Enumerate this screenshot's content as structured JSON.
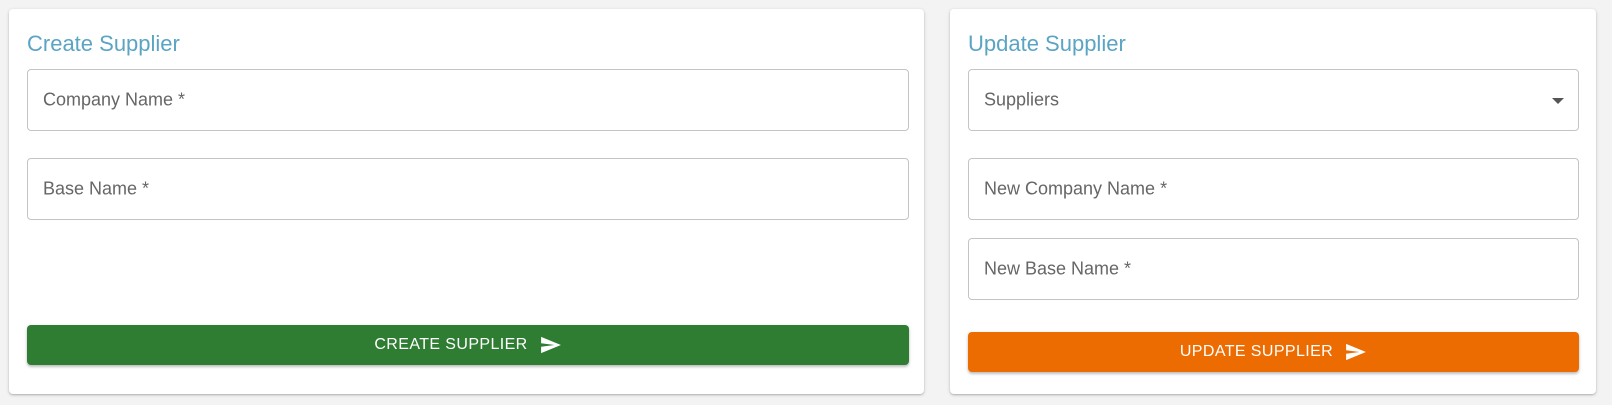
{
  "create": {
    "title": "Create Supplier",
    "company_name_label": "Company Name *",
    "base_name_label": "Base Name *",
    "submit_label": "CREATE SUPPLIER",
    "submit_color": "#2e7d32"
  },
  "update": {
    "title": "Update Supplier",
    "suppliers_label": "Suppliers",
    "new_company_name_label": "New Company Name *",
    "new_base_name_label": "New Base Name *",
    "submit_label": "UPDATE SUPPLIER",
    "submit_color": "#ed6c02"
  },
  "theme": {
    "title_color": "#5ba4c4",
    "icon": "send-icon"
  }
}
